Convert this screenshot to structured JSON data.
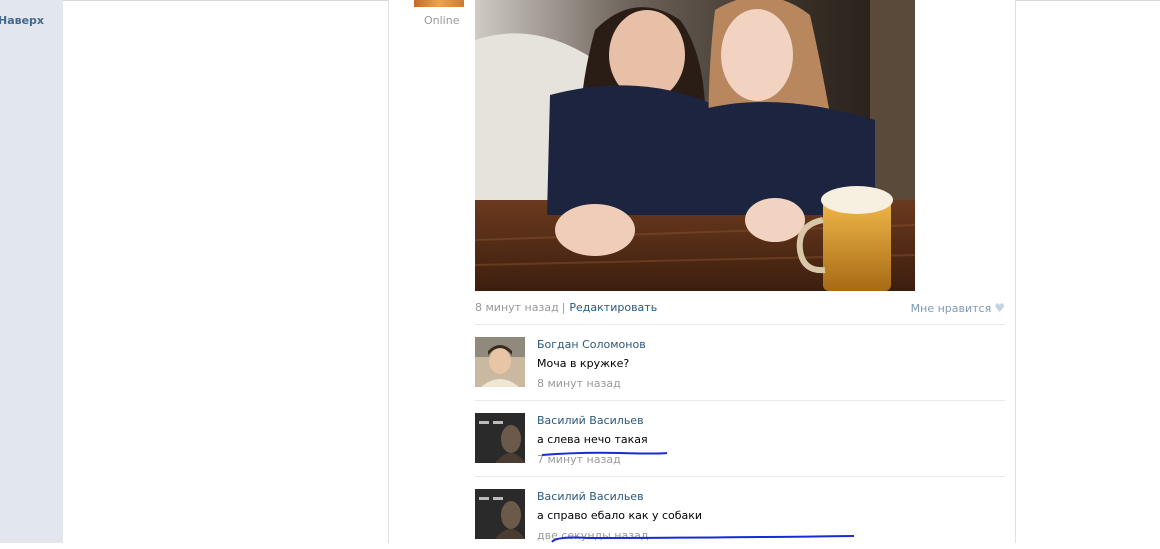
{
  "nav": {
    "to_top_label": "Наверх"
  },
  "post": {
    "author_status": "Online",
    "time": "8 минут назад",
    "separator": "|",
    "edit_label": "Редактировать",
    "like_label": "Мне нравится"
  },
  "comments": [
    {
      "author": "Богдан Соломонов",
      "text": "Моча в кружке?",
      "time": "8 минут назад"
    },
    {
      "author": "Василий Васильев",
      "text": "а слева нечо такая",
      "time": "7 минут назад"
    },
    {
      "author": "Василий Васильев",
      "text": "а справо ебало как у собаки",
      "time": "две секунды назад"
    }
  ],
  "colors": {
    "link": "#2b587a",
    "nav_link": "#45688e",
    "muted": "#999999",
    "sidebar_bg": "#e1e7ed",
    "annotation_ink": "#1a2bd6"
  }
}
